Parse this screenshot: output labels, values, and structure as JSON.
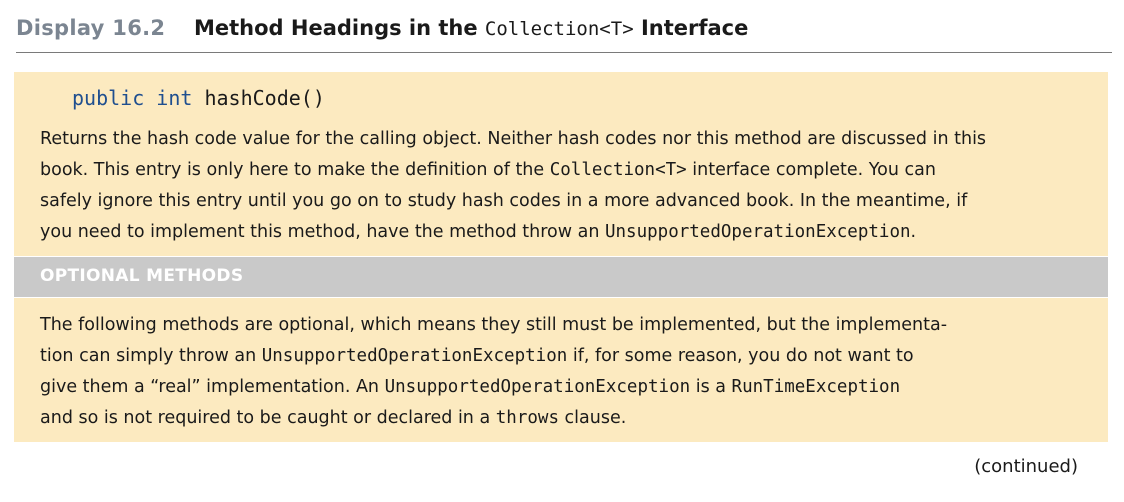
{
  "header": {
    "display_label": "Display 16.2",
    "title_pre": "Method Headings in the ",
    "title_code": "Collection<T>",
    "title_post": " Interface"
  },
  "hashcode_entry": {
    "sig_public": "public",
    "sig_int": "int",
    "sig_name": "hashCode()",
    "lines": [
      {
        "t1": "Returns the hash code value for the calling object. Neither hash codes nor this method are discussed in this"
      },
      {
        "t1": "book. This entry is only here to make the definition of the ",
        "code": "Collection<T>",
        "t2": " interface complete. You can"
      },
      {
        "t1": "safely ignore this entry until you go on to study hash codes in a more advanced book. In the meantime, if"
      },
      {
        "t1": "you need to implement this method, have the method throw an ",
        "code": "UnsupportedOperationException",
        "t2": "."
      }
    ]
  },
  "section": {
    "label": "OPTIONAL METHODS"
  },
  "optional_entry": {
    "lines": [
      {
        "t1": "The following methods are optional, which means they still must be implemented, but the implementa-"
      },
      {
        "t1": "tion can simply throw an ",
        "code": "UnsupportedOperationException",
        "t2": " if, for some reason, you do not want to"
      },
      {
        "t1": "give them a “real” implementation. An ",
        "code": "UnsupportedOperationException",
        "t2": " is a ",
        "code2": "RunTimeException"
      },
      {
        "t1": "and so is not required to be caught or declared in a ",
        "code": "throws",
        "t2": " clause."
      }
    ]
  },
  "footer": {
    "continued": "(continued)"
  }
}
